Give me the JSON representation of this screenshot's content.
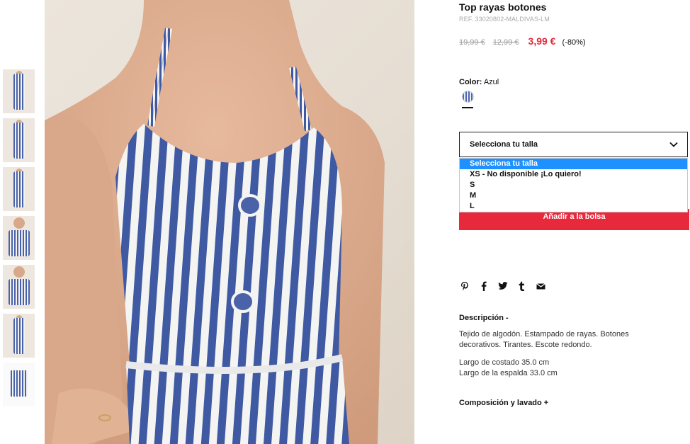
{
  "product": {
    "title": "Top rayas botones",
    "ref": "REF. 33020802-MALDIVAS-LM",
    "prices": {
      "original": "19,99 €",
      "previous": "12,99 €",
      "current": "3,99 €",
      "discount": "(-80%)"
    }
  },
  "color": {
    "label": "Color:",
    "value": "Azul"
  },
  "size_select": {
    "selected": "Selecciona tu talla",
    "options": [
      "Selecciona tu talla",
      "XS - No disponible ¡Lo quiero!",
      "S",
      "M",
      "L"
    ]
  },
  "add_button": "Añadir a la bolsa",
  "share_icons": [
    "pinterest-icon",
    "facebook-icon",
    "twitter-icon",
    "tumblr-icon",
    "mail-icon"
  ],
  "description": {
    "heading": "Descripción -",
    "text": "Tejido de algodón. Estampado de rayas. Botones decorativos. Tirantes. Escote redondo.",
    "measure_side": "Largo de costado 35.0 cm",
    "measure_back": "Largo de la espalda 33.0 cm"
  },
  "composition_heading": "Composición y lavado +",
  "colors": {
    "price_red": "#e02b3b",
    "button_red": "#e8283b",
    "option_highlight": "#1e90ff",
    "stripe_blue": "#3f59a3"
  }
}
